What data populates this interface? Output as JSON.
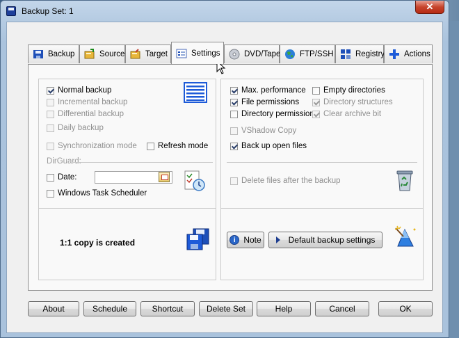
{
  "window": {
    "title": "Backup Set: 1",
    "close_label": "✕"
  },
  "tabs": [
    {
      "label": "Backup",
      "icon": "backup-icon",
      "active": false
    },
    {
      "label": "Source",
      "icon": "source-icon",
      "active": false
    },
    {
      "label": "Target",
      "icon": "target-icon",
      "active": false
    },
    {
      "label": "Settings",
      "icon": "settings-icon",
      "active": true
    },
    {
      "label": "DVD/Tape",
      "icon": "dvd-icon",
      "active": false
    },
    {
      "label": "FTP/SSH",
      "icon": "globe-icon",
      "active": false
    },
    {
      "label": "Registry",
      "icon": "registry-icon",
      "active": false
    },
    {
      "label": "Actions",
      "icon": "plus-icon",
      "active": false
    }
  ],
  "left": {
    "mode_options": [
      {
        "label": "Normal backup",
        "checked": true,
        "enabled": true
      },
      {
        "label": "Incremental backup",
        "checked": false,
        "enabled": false
      },
      {
        "label": "Differential backup",
        "checked": false,
        "enabled": false
      },
      {
        "label": "Daily backup",
        "checked": false,
        "enabled": false
      }
    ],
    "sync_mode": {
      "label": "Synchronization mode",
      "checked": false,
      "enabled": false
    },
    "refresh_mode": {
      "label": "Refresh mode",
      "checked": false,
      "enabled": true
    },
    "dirguard_label": "DirGuard:",
    "date": {
      "label": "Date:",
      "checked": false,
      "value": ""
    },
    "task_scheduler": {
      "label": "Windows Task Scheduler",
      "checked": false
    },
    "status_text": "1:1 copy is created"
  },
  "right": {
    "options_col1": [
      {
        "label": "Max. performance",
        "checked": true,
        "enabled": true
      },
      {
        "label": "File permissions",
        "checked": true,
        "enabled": true
      },
      {
        "label": "Directory permissions",
        "checked": false,
        "enabled": true
      }
    ],
    "options_col2": [
      {
        "label": "Empty directories",
        "checked": false,
        "enabled": true
      },
      {
        "label": "Directory structures",
        "checked": true,
        "enabled": false
      },
      {
        "label": "Clear archive bit",
        "checked": true,
        "enabled": false
      }
    ],
    "vshadow": {
      "label": "VShadow Copy",
      "checked": false,
      "enabled": false
    },
    "open_files": {
      "label": "Back up open files",
      "checked": true,
      "enabled": true
    },
    "delete_after": {
      "label": "Delete files after the backup",
      "checked": false,
      "enabled": false
    },
    "note_button": "Note",
    "default_settings_button": "Default backup settings"
  },
  "bottom_buttons": {
    "about": "About",
    "schedule": "Schedule",
    "shortcut": "Shortcut",
    "delete_set": "Delete Set",
    "help": "Help",
    "cancel": "Cancel",
    "ok": "OK"
  },
  "colors": {
    "accent_blue": "#1e5bd8",
    "panel_bg": "#f9f9f9",
    "dialog_bg": "#f0f0f0"
  }
}
